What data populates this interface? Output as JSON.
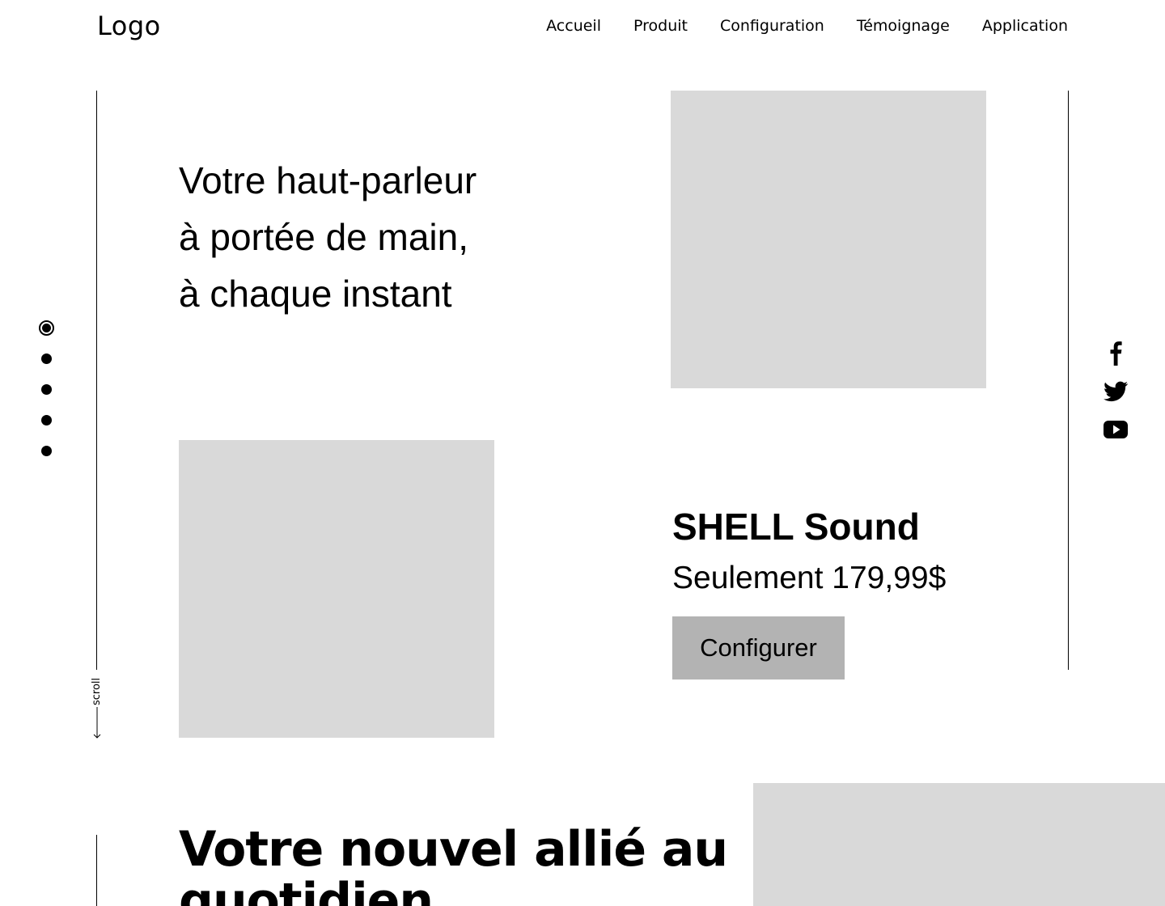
{
  "header": {
    "logo": "Logo",
    "nav": [
      {
        "label": "Accueil"
      },
      {
        "label": "Produit"
      },
      {
        "label": "Configuration"
      },
      {
        "label": "Témoignage"
      },
      {
        "label": "Application"
      }
    ]
  },
  "side_nav": {
    "dots_count": 5,
    "active_index": 0
  },
  "scroll": {
    "label": "scroll",
    "arrow": "←"
  },
  "hero": {
    "title_lines": [
      "Votre haut-parleur",
      "à portée de main,",
      "à chaque instant"
    ]
  },
  "product": {
    "name": "SHELL Sound",
    "price": "Seulement 179,99$",
    "cta": "Configurer"
  },
  "social": [
    {
      "icon": "facebook-icon"
    },
    {
      "icon": "twitter-icon"
    },
    {
      "icon": "youtube-icon"
    }
  ],
  "section2": {
    "title": "Votre nouvel allié au quotidien"
  },
  "colors": {
    "placeholder": "#d9d9d9",
    "button": "#b3b3b3",
    "text": "#000000",
    "background": "#ffffff"
  }
}
